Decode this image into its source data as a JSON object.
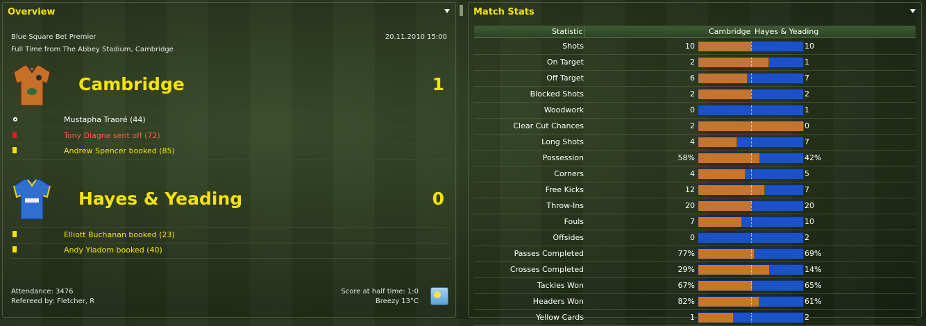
{
  "overview": {
    "title": "Overview",
    "competition": "Blue Square Bet Premier",
    "datetime": "20.11.2010 15:00",
    "venue": "Full Time from The Abbey Stadium, Cambridge",
    "home": {
      "name": "Cambridge",
      "score": "1",
      "events": [
        {
          "icon": "ball",
          "text": "Mustapha Traoré (44)",
          "color": "#ffffff"
        },
        {
          "icon": "red-card",
          "text": "Tony Diagne sent off (72)",
          "color": "#ff5a46"
        },
        {
          "icon": "yellow-card",
          "text": "Andrew Spencer booked (85)",
          "color": "#f5e400"
        }
      ]
    },
    "away": {
      "name": "Hayes & Yeading",
      "score": "0",
      "events": [
        {
          "icon": "yellow-card",
          "text": "Elliott Buchanan booked (23)",
          "color": "#f5e400"
        },
        {
          "icon": "yellow-card",
          "text": "Andy Yiadom booked (40)",
          "color": "#f5e400"
        }
      ]
    },
    "attendance": "Attendance: 3476",
    "referee": "Refereed by: Fletcher, R",
    "halftime": "Score at half time: 1:0",
    "weather": "Breezy 13°C",
    "weather_icon": "sun-icon"
  },
  "stats": {
    "title": "Match Stats",
    "headers": {
      "statistic": "Statistic",
      "home": "Cambridge",
      "away": "Hayes & Yeading"
    },
    "home_color": "#c4762f",
    "away_color": "#1c52c8",
    "rows": [
      {
        "label": "Shots",
        "home": "10",
        "away": "10",
        "share": 0.5
      },
      {
        "label": "On Target",
        "home": "2",
        "away": "1",
        "share": 0.667
      },
      {
        "label": "Off Target",
        "home": "6",
        "away": "7",
        "share": 0.462
      },
      {
        "label": "Blocked Shots",
        "home": "2",
        "away": "2",
        "share": 0.5
      },
      {
        "label": "Woodwork",
        "home": "0",
        "away": "1",
        "share": 0
      },
      {
        "label": "Clear Cut Chances",
        "home": "2",
        "away": "0",
        "share": 1
      },
      {
        "label": "Long Shots",
        "home": "4",
        "away": "7",
        "share": 0.364
      },
      {
        "label": "Possession",
        "home": "58%",
        "away": "42%",
        "share": 0.58
      },
      {
        "label": "Corners",
        "home": "4",
        "away": "5",
        "share": 0.444
      },
      {
        "label": "Free Kicks",
        "home": "12",
        "away": "7",
        "share": 0.632
      },
      {
        "label": "Throw-Ins",
        "home": "20",
        "away": "20",
        "share": 0.5
      },
      {
        "label": "Fouls",
        "home": "7",
        "away": "10",
        "share": 0.412
      },
      {
        "label": "Offsides",
        "home": "0",
        "away": "2",
        "share": 0
      },
      {
        "label": "Passes Completed",
        "home": "77%",
        "away": "69%",
        "share": 0.527
      },
      {
        "label": "Crosses Completed",
        "home": "29%",
        "away": "14%",
        "share": 0.674
      },
      {
        "label": "Tackles Won",
        "home": "67%",
        "away": "65%",
        "share": 0.508
      },
      {
        "label": "Headers Won",
        "home": "82%",
        "away": "61%",
        "share": 0.573
      },
      {
        "label": "Yellow Cards",
        "home": "1",
        "away": "2",
        "share": 0.333
      }
    ]
  }
}
